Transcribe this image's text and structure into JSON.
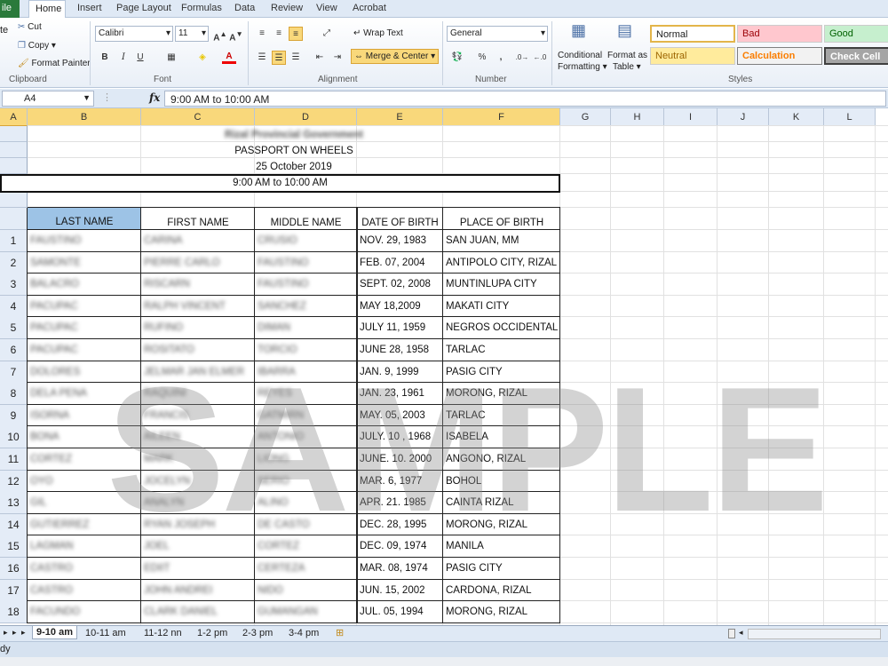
{
  "ribbon_tabs": {
    "file": "ile",
    "home": "Home",
    "insert": "Insert",
    "page_layout": "Page Layout",
    "formulas": "Formulas",
    "data": "Data",
    "review": "Review",
    "view": "View",
    "acrobat": "Acrobat"
  },
  "clipboard": {
    "paste": "te",
    "cut": "Cut",
    "copy": "Copy",
    "format_painter": "Format Painter",
    "label": "Clipboard"
  },
  "font": {
    "name": "Calibri",
    "size": "11",
    "bold": "B",
    "italic": "I",
    "underline": "U",
    "label": "Font"
  },
  "alignment": {
    "wrap_text": "Wrap Text",
    "merge_center": "Merge & Center",
    "label": "Alignment"
  },
  "number": {
    "format": "General",
    "percent": "%",
    "comma": ",",
    "label": "Number"
  },
  "styles": {
    "conditional_1": "Conditional",
    "conditional_2": "Formatting",
    "format_as_1": "Format as",
    "format_as_2": "Table",
    "normal": "Normal",
    "bad": "Bad",
    "good": "Good",
    "neutral": "Neutral",
    "calculation": "Calculation",
    "check_cell": "Check Cell",
    "label": "Styles"
  },
  "formula_bar": {
    "cell_ref": "A4",
    "fx": "fx",
    "content": "9:00 AM to 10:00 AM"
  },
  "columns": [
    "A",
    "B",
    "C",
    "D",
    "E",
    "F",
    "G",
    "H",
    "I",
    "J",
    "K",
    "L"
  ],
  "sheet": {
    "header_line1": "Rizal Provincial Government",
    "title": "PASSPORT ON WHEELS",
    "date": "25 October 2019",
    "time": "9:00 AM to 10:00 AM",
    "headers": [
      "LAST NAME",
      "FIRST NAME",
      "MIDDLE NAME",
      "DATE OF BIRTH",
      "PLACE OF BIRTH"
    ],
    "rows": [
      {
        "n": "1",
        "last": "FAUSTINO",
        "first": "CARINA",
        "middle": "CRUSIO",
        "dob": "NOV. 29, 1983",
        "pob": "SAN JUAN, MM"
      },
      {
        "n": "2",
        "last": "SAMONTE",
        "first": "PIERRE CARLO",
        "middle": "FAUSTINO",
        "dob": "FEB. 07, 2004",
        "pob": "ANTIPOLO CITY, RIZAL"
      },
      {
        "n": "3",
        "last": "BALACRO",
        "first": "RISCARN",
        "middle": "FAUSTINO",
        "dob": "SEPT. 02, 2008",
        "pob": "MUNTINLUPA CITY"
      },
      {
        "n": "4",
        "last": "PACUPAC",
        "first": "RALPH VINCENT",
        "middle": "SANCHEZ",
        "dob": "MAY 18,2009",
        "pob": "MAKATI CITY"
      },
      {
        "n": "5",
        "last": "PACUPAC",
        "first": "RUFINO",
        "middle": "DIMAN",
        "dob": "JULY 11, 1959",
        "pob": "NEGROS OCCIDENTAL"
      },
      {
        "n": "6",
        "last": "PACUPAC",
        "first": "ROSITATO",
        "middle": "TORCIO",
        "dob": "JUNE 28, 1958",
        "pob": "TARLAC"
      },
      {
        "n": "7",
        "last": "DOLORES",
        "first": "JELMAR JAN ELMER",
        "middle": "IBARRA",
        "dob": "JAN. 9, 1999",
        "pob": "PASIG CITY"
      },
      {
        "n": "8",
        "last": "DELA PEÑA",
        "first": "RAQUINI",
        "middle": "REYES",
        "dob": "JAN. 23, 1961",
        "pob": "MORONG, RIZAL"
      },
      {
        "n": "9",
        "last": "ISORNA",
        "first": "FRANCIS",
        "middle": "GATMIRN",
        "dob": "MAY. 05, 2003",
        "pob": "TARLAC"
      },
      {
        "n": "10",
        "last": "BONA",
        "first": "AILEEN",
        "middle": "ANTONIO",
        "dob": "JULY. 10 , 1968",
        "pob": "ISABELA"
      },
      {
        "n": "11",
        "last": "CORTEZ",
        "first": "MARK",
        "middle": "LIONG",
        "dob": "JUNE. 10. 2000",
        "pob": "ANGONO, RIZAL"
      },
      {
        "n": "12",
        "last": "OYO",
        "first": "JOCELYN",
        "middle": "SERIO",
        "dob": "MAR. 6, 1977",
        "pob": "BOHOL"
      },
      {
        "n": "13",
        "last": "GIL",
        "first": "ANALYN",
        "middle": "ALIÑO",
        "dob": "APR. 21. 1985",
        "pob": "CAINTA RIZAL"
      },
      {
        "n": "14",
        "last": "GUTIERREZ",
        "first": "RYAN JOSEPH",
        "middle": "DE CASTO",
        "dob": "DEC. 28, 1995",
        "pob": "MORONG, RIZAL"
      },
      {
        "n": "15",
        "last": "LAGMAN",
        "first": "JOEL",
        "middle": "CORTEZ",
        "dob": "DEC. 09, 1974",
        "pob": "MANILA"
      },
      {
        "n": "16",
        "last": "CASTRO",
        "first": "EDIIT",
        "middle": "CERTEZA",
        "dob": "MAR. 08, 1974",
        "pob": "PASIG CITY"
      },
      {
        "n": "17",
        "last": "CASTRO",
        "first": "JOHN ANDREI",
        "middle": "NIDO",
        "dob": "JUN. 15, 2002",
        "pob": "CARDONA, RIZAL"
      },
      {
        "n": "18",
        "last": "FACUNDO",
        "first": "CLARK DANIEL",
        "middle": "GUMANGAN",
        "dob": "JUL. 05, 1994",
        "pob": "MORONG, RIZAL"
      }
    ]
  },
  "watermark": "SAMPLE",
  "sheet_tabs": [
    "9-10 am",
    "10-11 am",
    "11-12 nn",
    "1-2 pm",
    "2-3 pm",
    "3-4 pm"
  ],
  "status": "dy"
}
